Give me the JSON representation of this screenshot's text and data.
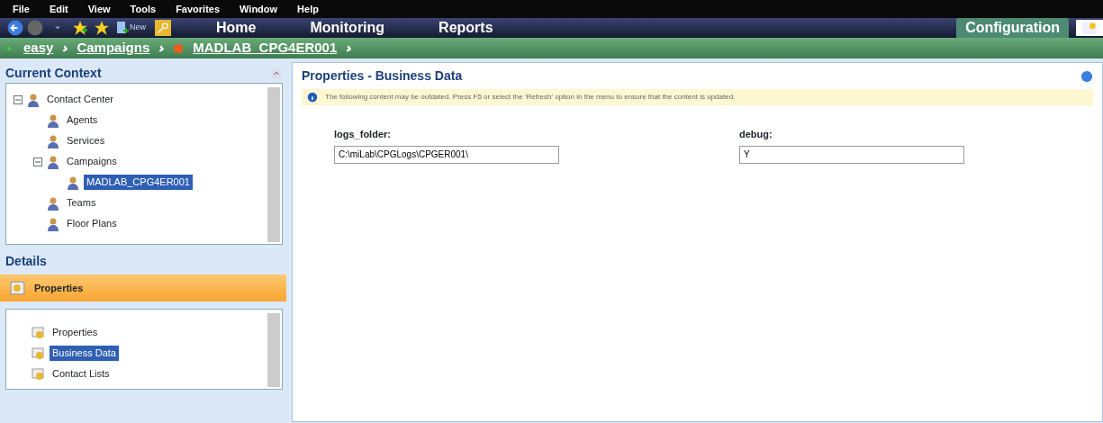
{
  "menu": [
    "File",
    "Edit",
    "View",
    "Tools",
    "Favorites",
    "Window",
    "Help"
  ],
  "toolbar": {
    "new_label": "New"
  },
  "tabs": [
    {
      "label": "Home",
      "selected": false
    },
    {
      "label": "Monitoring",
      "selected": false
    },
    {
      "label": "Reports",
      "selected": false
    },
    {
      "label": "Configuration",
      "selected": true
    }
  ],
  "breadcrumb": [
    {
      "label": "easy",
      "kind": "root"
    },
    {
      "label": "Campaigns",
      "kind": "folder"
    },
    {
      "label": "MADLAB_CPG4ER001",
      "kind": "item"
    }
  ],
  "context": {
    "title": "Current Context",
    "tree": [
      {
        "label": "Contact Center",
        "expanded": true,
        "selected": false,
        "children": [
          {
            "label": "Agents",
            "selected": false
          },
          {
            "label": "Services",
            "selected": false
          },
          {
            "label": "Campaigns",
            "expanded": true,
            "selected": false,
            "children": [
              {
                "label": "MADLAB_CPG4ER001",
                "selected": true
              }
            ]
          },
          {
            "label": "Teams",
            "selected": false
          },
          {
            "label": "Floor Plans",
            "selected": false
          }
        ]
      }
    ]
  },
  "details": {
    "title": "Details",
    "section": "Properties",
    "items": [
      {
        "label": "Properties",
        "selected": false
      },
      {
        "label": "Business Data",
        "selected": true
      },
      {
        "label": "Contact Lists",
        "selected": false
      }
    ]
  },
  "main": {
    "title": "Properties - Business Data",
    "notice": "The following content may be outdated. Press F5 or select the 'Refresh' option in the menu to ensure that the content is updated.",
    "fields": [
      {
        "label": "logs_folder:",
        "value": "C:\\miLab\\CPGLogs\\CPGER001\\"
      },
      {
        "label": "debug:",
        "value": "Y"
      }
    ]
  }
}
